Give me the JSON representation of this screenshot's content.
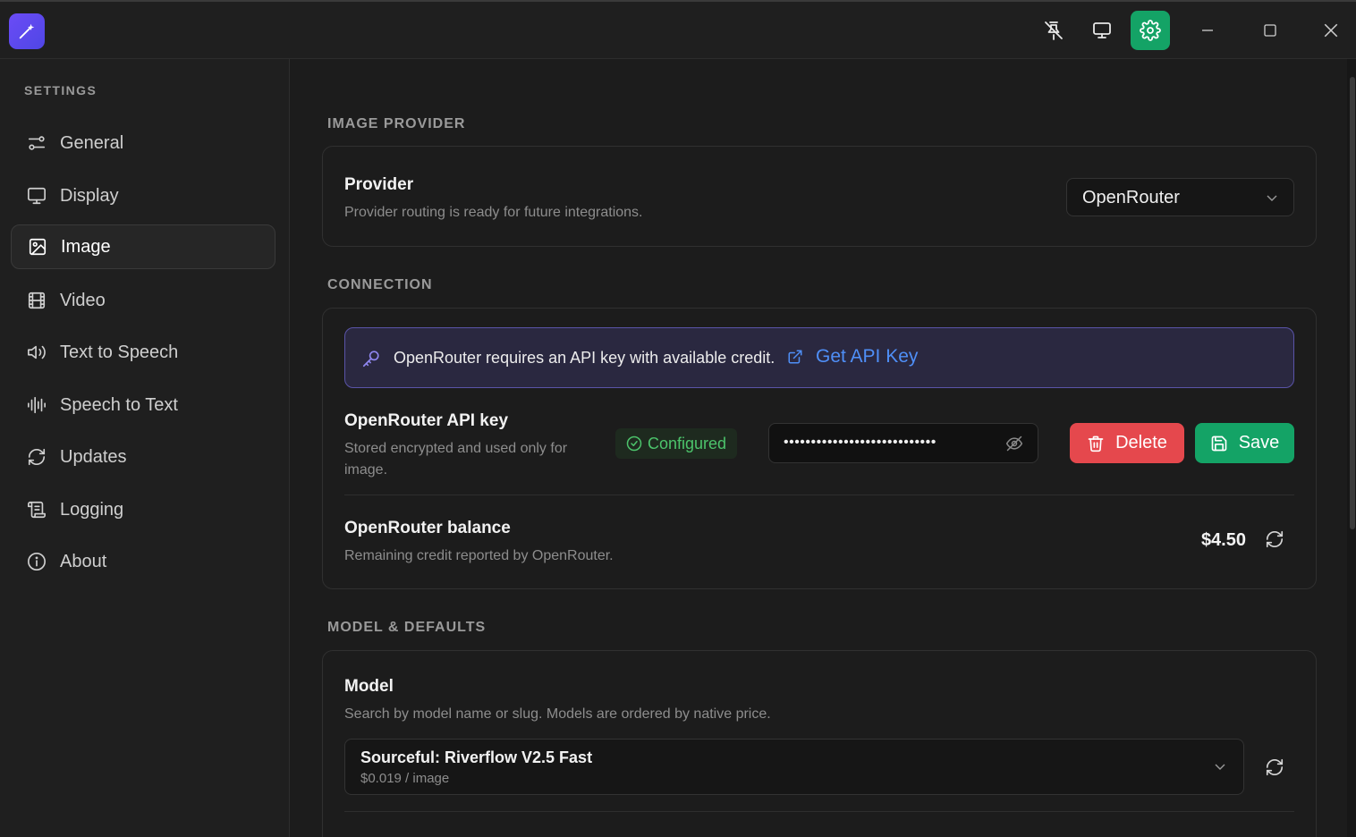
{
  "titlebar": {
    "logo_icon": "magic-wand-icon",
    "buttons": [
      {
        "icon": "pin-off-icon"
      },
      {
        "icon": "monitor-icon"
      },
      {
        "icon": "gear-icon",
        "active": true
      }
    ],
    "window_controls": [
      "minimize-icon",
      "maximize-icon",
      "close-icon"
    ]
  },
  "sidebar": {
    "title": "SETTINGS",
    "items": [
      {
        "label": "General",
        "icon": "sliders-icon"
      },
      {
        "label": "Display",
        "icon": "monitor-icon"
      },
      {
        "label": "Image",
        "icon": "image-icon",
        "active": true
      },
      {
        "label": "Video",
        "icon": "film-icon"
      },
      {
        "label": "Text to Speech",
        "icon": "speaker-icon"
      },
      {
        "label": "Speech to Text",
        "icon": "waveform-icon"
      },
      {
        "label": "Updates",
        "icon": "refresh-icon"
      },
      {
        "label": "Logging",
        "icon": "scroll-icon"
      },
      {
        "label": "About",
        "icon": "info-icon"
      }
    ]
  },
  "main": {
    "image_provider": {
      "section_title": "IMAGE PROVIDER",
      "provider_title": "Provider",
      "provider_desc": "Provider routing is ready for future integrations.",
      "provider_value": "OpenRouter"
    },
    "connection": {
      "section_title": "CONNECTION",
      "notice_text": "OpenRouter requires an API key with available credit.",
      "notice_link": "Get API Key",
      "api_key_title": "OpenRouter API key",
      "api_key_desc": "Stored encrypted and used only for image.",
      "status_badge": "Configured",
      "api_key_masked": "••••••••••••••••••••••••••••",
      "delete_label": "Delete",
      "save_label": "Save",
      "balance_title": "OpenRouter balance",
      "balance_desc": "Remaining credit reported by OpenRouter.",
      "balance_value": "$4.50"
    },
    "model_defaults": {
      "section_title": "MODEL & DEFAULTS",
      "model_title": "Model",
      "model_desc": "Search by model name or slug. Models are ordered by native price.",
      "model_name": "Sourceful: Riverflow V2.5 Fast",
      "model_price": "$0.019 / image"
    }
  },
  "colors": {
    "accent_green": "#14a366",
    "delete_red": "#e5484d",
    "link_blue": "#4f8ff7",
    "notice_bg": "#2a2840",
    "notice_border": "#5a54a8",
    "configured_green": "#4cc36b"
  }
}
